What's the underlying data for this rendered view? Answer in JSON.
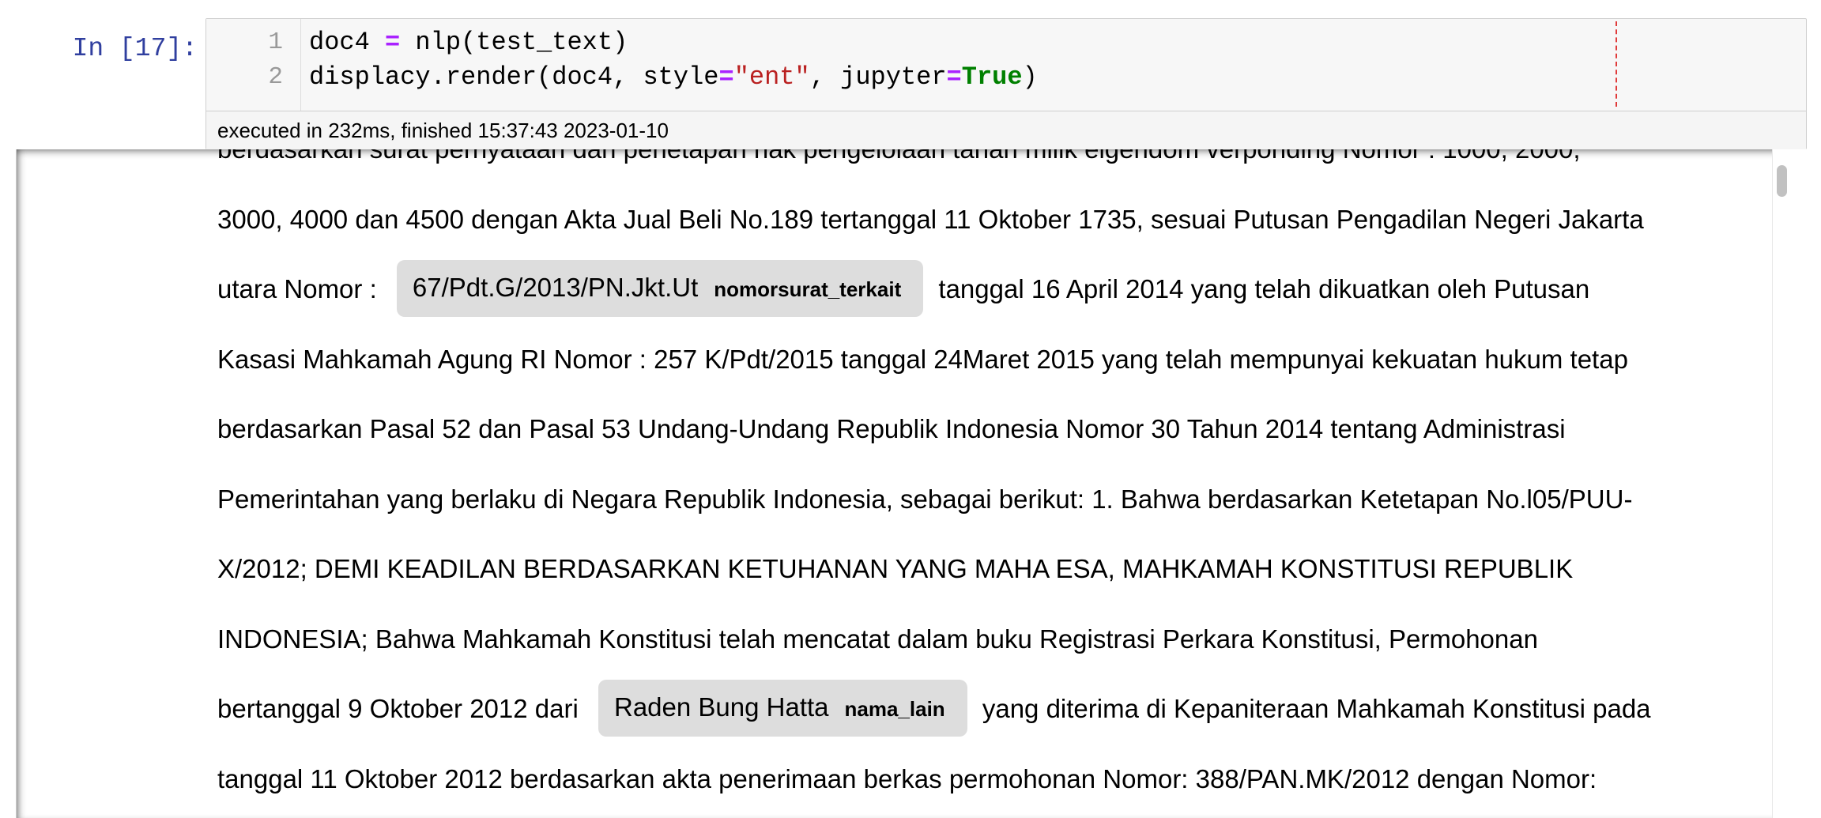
{
  "cell": {
    "prompt": "In [17]:",
    "lines": [
      {
        "num": "1",
        "tokens": [
          {
            "t": "doc4 "
          },
          {
            "t": "=",
            "c": "tok-op"
          },
          {
            "t": " nlp(test_text)"
          }
        ]
      },
      {
        "num": "2",
        "tokens": [
          {
            "t": "displacy.render(doc4, style"
          },
          {
            "t": "=",
            "c": "tok-op"
          },
          {
            "t": "\"ent\"",
            "c": "tok-str"
          },
          {
            "t": ", jupyter"
          },
          {
            "t": "=",
            "c": "tok-op"
          },
          {
            "t": "True",
            "c": "tok-kw"
          },
          {
            "t": ")"
          }
        ]
      }
    ],
    "execution_status": "executed in 232ms, finished 15:37:43 2023-01-10"
  },
  "output": {
    "lines": [
      {
        "parts": [
          {
            "text": "berdasarkan surat pernyataan dan penetapan hak pengelolaan tanah milik eigendom verponding Nomor : 1000, 2000,"
          }
        ]
      },
      {
        "parts": [
          {
            "text": "3000, 4000 dan 4500 dengan Akta Jual Beli No.189 tertanggal 11 Oktober 1735, sesuai Putusan Pengadilan Negeri Jakarta"
          }
        ]
      },
      {
        "parts": [
          {
            "text": "utara Nomor : "
          },
          {
            "entity": "67/Pdt.G/2013/PN.Jkt.Ut",
            "label": "nomorsurat_terkait"
          },
          {
            "text": " tanggal 16 April 2014 yang telah dikuatkan oleh Putusan"
          }
        ]
      },
      {
        "parts": [
          {
            "text": "Kasasi Mahkamah Agung RI Nomor : 257 K/Pdt/2015 tanggal 24Maret 2015 yang telah mempunyai kekuatan hukum tetap"
          }
        ]
      },
      {
        "parts": [
          {
            "text": "berdasarkan Pasal 52 dan Pasal 53 Undang-Undang Republik Indonesia Nomor 30 Tahun 2014 tentang Administrasi"
          }
        ]
      },
      {
        "parts": [
          {
            "text": "Pemerintahan yang berlaku di Negara Republik Indonesia, sebagai berikut: 1. Bahwa berdasarkan Ketetapan No.l05/PUU-"
          }
        ]
      },
      {
        "parts": [
          {
            "text": "X/2012; DEMI KEADILAN BERDASARKAN KETUHANAN YANG MAHA ESA, MAHKAMAH KONSTITUSI REPUBLIK"
          }
        ]
      },
      {
        "parts": [
          {
            "text": "INDONESIA; Bahwa Mahkamah Konstitusi telah mencatat dalam buku Registrasi Perkara Konstitusi, Permohonan"
          }
        ]
      },
      {
        "parts": [
          {
            "text": "bertanggal 9 Oktober 2012 dari "
          },
          {
            "entity": "Raden Bung Hatta",
            "label": "nama_lain"
          },
          {
            "text": " yang diterima di Kepaniteraan Mahkamah Konstitusi pada"
          }
        ]
      },
      {
        "parts": [
          {
            "text": "tanggal 11 Oktober 2012 berdasarkan akta penerimaan berkas permohonan Nomor: 388/PAN.MK/2012 dengan Nomor:"
          }
        ]
      }
    ]
  }
}
